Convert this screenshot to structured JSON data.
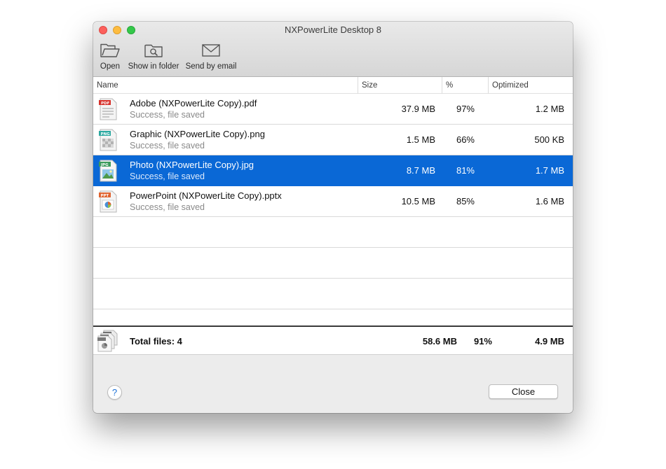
{
  "window": {
    "title": "NXPowerLite Desktop 8"
  },
  "toolbar": {
    "open": {
      "label": "Open",
      "icon": "folder-open-icon"
    },
    "show_in_folder": {
      "label": "Show in folder",
      "icon": "folder-search-icon"
    },
    "send_by_email": {
      "label": "Send by email",
      "icon": "envelope-icon"
    }
  },
  "columns": {
    "name": "Name",
    "size": "Size",
    "percent": "%",
    "optimized": "Optimized"
  },
  "files": [
    {
      "name": "Adobe (NXPowerLite Copy).pdf",
      "status": "Success, file saved",
      "size": "37.9 MB",
      "percent": "97%",
      "optimized": "1.2 MB",
      "type": "PDF",
      "color": "#d6302a"
    },
    {
      "name": "Graphic (NXPowerLite Copy).png",
      "status": "Success, file saved",
      "size": "1.5 MB",
      "percent": "66%",
      "optimized": "500 KB",
      "type": "PNG",
      "color": "#2aa8a0"
    },
    {
      "name": "Photo (NXPowerLite Copy).jpg",
      "status": "Success, file saved",
      "size": "8.7 MB",
      "percent": "81%",
      "optimized": "1.7 MB",
      "type": "JPG",
      "color": "#3b9a5c"
    },
    {
      "name": "PowerPoint (NXPowerLite Copy).pptx",
      "status": "Success, file saved",
      "size": "10.5 MB",
      "percent": "85%",
      "optimized": "1.6 MB",
      "type": "PPT",
      "color": "#e0632f"
    }
  ],
  "selected_index": 2,
  "total": {
    "label": "Total files: 4",
    "size": "58.6 MB",
    "percent": "91%",
    "optimized": "4.9 MB"
  },
  "footer": {
    "help": "?",
    "close": "Close"
  },
  "colors": {
    "selection": "#0a68d6",
    "status_text": "#8a8a8a"
  }
}
